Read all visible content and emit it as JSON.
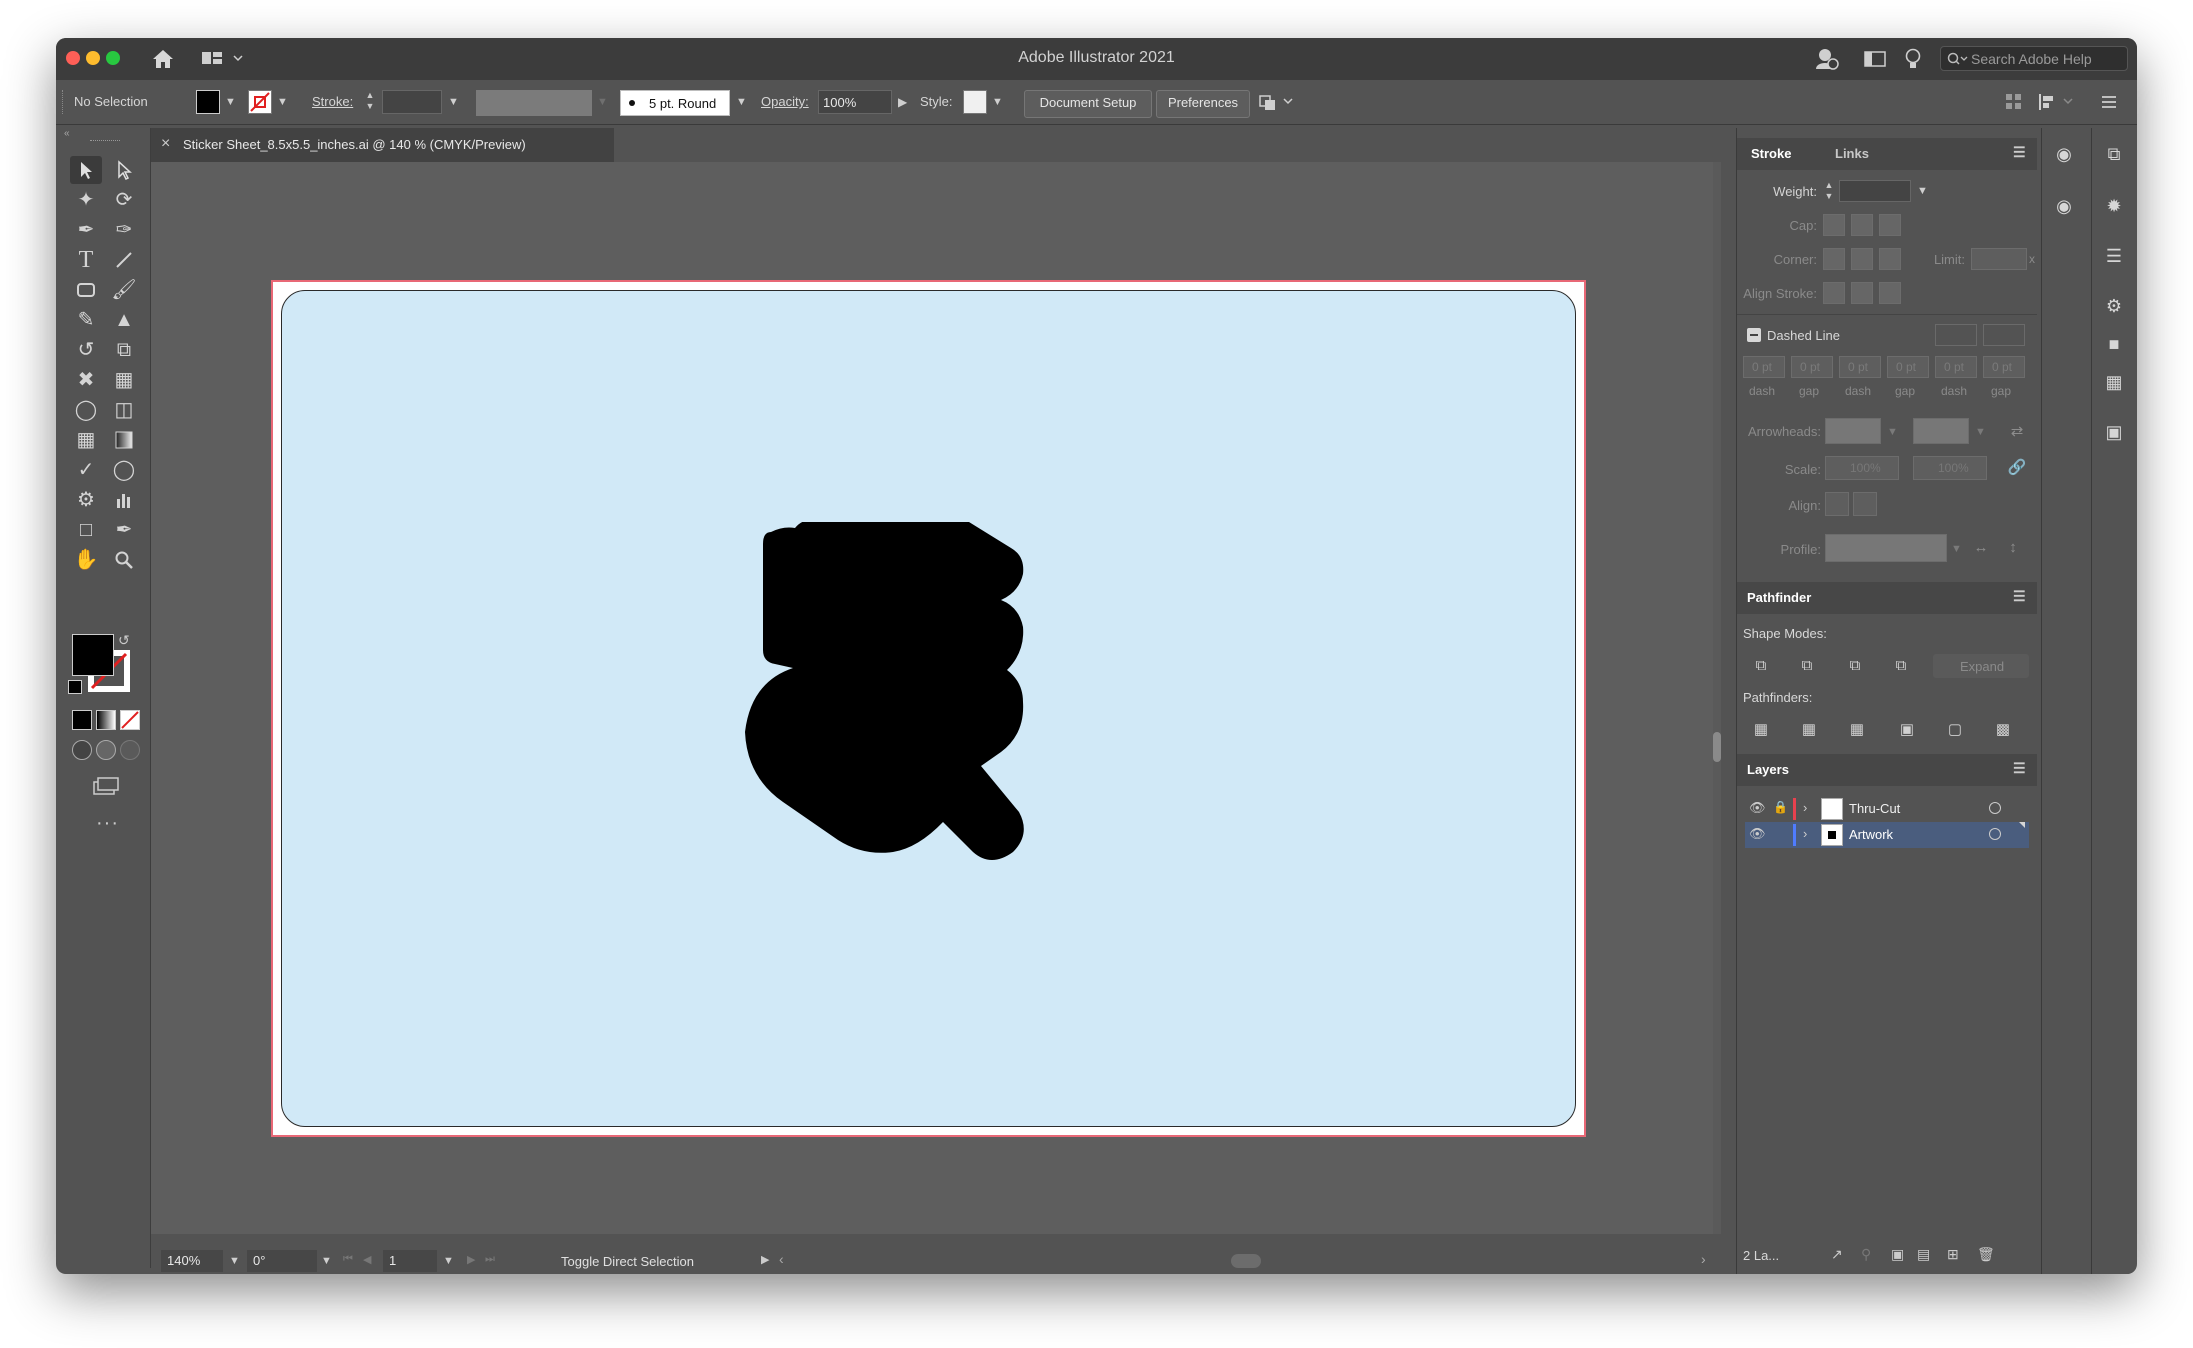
{
  "app": {
    "title": "Adobe Illustrator 2021"
  },
  "titlebar": {
    "search_placeholder": "Search Adobe Help"
  },
  "control_bar": {
    "selection_label": "No Selection",
    "stroke_label": "Stroke:",
    "brush_label": "5 pt. Round",
    "opacity_label": "Opacity:",
    "opacity_value": "100%",
    "style_label": "Style:",
    "document_setup": "Document Setup",
    "preferences": "Preferences"
  },
  "document": {
    "tab_label": "Sticker Sheet_8.5x5.5_inches.ai @ 140 % (CMYK/Preview)",
    "close_icon": "×"
  },
  "status_bar": {
    "zoom": "140%",
    "rotation": "0°",
    "artboard_number": "1",
    "status_text": "Toggle Direct Selection"
  },
  "stroke_panel": {
    "tabs": [
      "Stroke",
      "Links"
    ],
    "weight_label": "Weight:",
    "cap_label": "Cap:",
    "corner_label": "Corner:",
    "limit_label": "Limit:",
    "limit_suffix": "x",
    "align_stroke_label": "Align Stroke:",
    "dashed_line_label": "Dashed Line",
    "dash_fields": [
      "0 pt",
      "0 pt",
      "0 pt",
      "0 pt",
      "0 pt",
      "0 pt"
    ],
    "dash_labels": [
      "dash",
      "gap",
      "dash",
      "gap",
      "dash",
      "gap"
    ],
    "arrowheads_label": "Arrowheads:",
    "scale_label": "Scale:",
    "scale_values": [
      "100%",
      "100%"
    ],
    "align_label": "Align:",
    "profile_label": "Profile:"
  },
  "pathfinder_panel": {
    "title": "Pathfinder",
    "shape_modes_label": "Shape Modes:",
    "expand_label": "Expand",
    "pathfinders_label": "Pathfinders:"
  },
  "layers_panel": {
    "title": "Layers",
    "layers": [
      {
        "name": "Thru-Cut",
        "color": "#e8414e"
      },
      {
        "name": "Artwork",
        "color": "#4f7cff"
      }
    ],
    "count_label": "2 La..."
  },
  "colors": {
    "artboard_fill": "#d1e9f7",
    "bleed_line": "#e86876",
    "layer_selected": "#4a5d7e"
  }
}
